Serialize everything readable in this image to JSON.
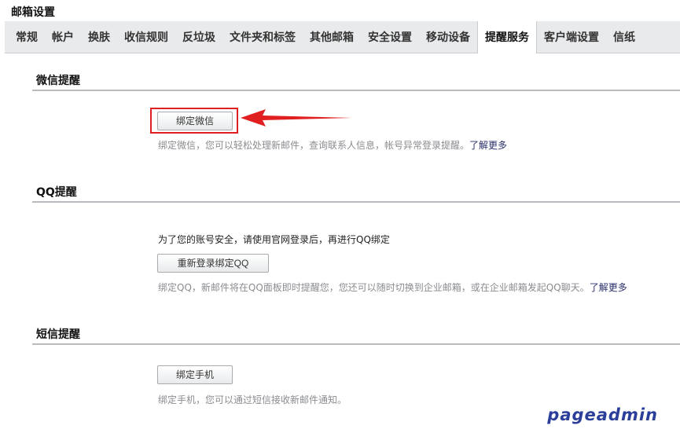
{
  "page_title": "邮箱设置",
  "tabs": [
    {
      "label": "常规"
    },
    {
      "label": "帐户"
    },
    {
      "label": "换肤"
    },
    {
      "label": "收信规则"
    },
    {
      "label": "反垃圾"
    },
    {
      "label": "文件夹和标签"
    },
    {
      "label": "其他邮箱"
    },
    {
      "label": "安全设置"
    },
    {
      "label": "移动设备"
    },
    {
      "label": "提醒服务",
      "active": true
    },
    {
      "label": "客户端设置"
    },
    {
      "label": "信纸"
    }
  ],
  "wechat": {
    "title": "微信提醒",
    "button": "绑定微信",
    "hint": "绑定微信，您可以轻松处理新邮件，查询联系人信息，帐号异常登录提醒。",
    "learn_more": "了解更多"
  },
  "qq": {
    "title": "QQ提醒",
    "notice": "为了您的账号安全，请使用官网登录后，再进行QQ绑定",
    "button": "重新登录绑定QQ",
    "hint": "绑定QQ，新邮件将在QQ面板即时提醒您，您还可以随时切换到企业邮箱，或在企业邮箱发起QQ聊天。",
    "learn_more": "了解更多"
  },
  "sms": {
    "title": "短信提醒",
    "button": "绑定手机",
    "hint": "绑定手机，您可以通过短信接收新邮件通知。"
  },
  "annotation_color": "#e02020",
  "watermark": "pageadmin"
}
